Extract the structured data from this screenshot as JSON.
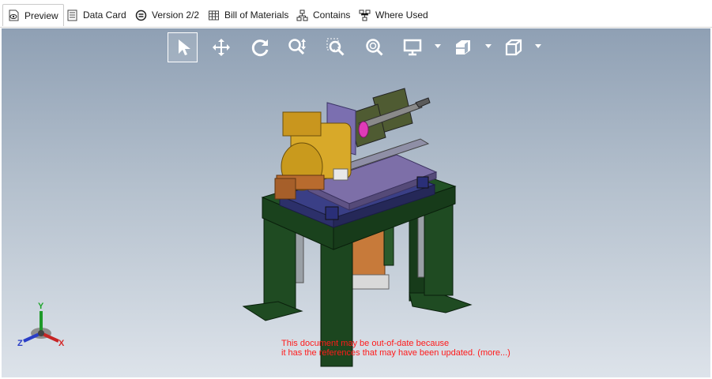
{
  "tabs": [
    {
      "label": "Preview",
      "icon": "eye-document-icon",
      "active": true
    },
    {
      "label": "Data Card",
      "icon": "data-card-icon"
    },
    {
      "label": "Version 2/2",
      "icon": "version-icon"
    },
    {
      "label": "Bill of Materials",
      "icon": "table-icon"
    },
    {
      "label": "Contains",
      "icon": "hierarchy-icon"
    },
    {
      "label": "Where Used",
      "icon": "where-used-icon"
    }
  ],
  "toolbar": {
    "buttons": [
      {
        "name": "select-tool",
        "icon": "arrow-cursor-icon",
        "selected": true
      },
      {
        "name": "pan-tool",
        "icon": "move-arrows-icon"
      },
      {
        "name": "rotate-tool",
        "icon": "rotate-icon"
      },
      {
        "name": "zoom-in-out-tool",
        "icon": "zoom-in-out-icon"
      },
      {
        "name": "zoom-to-area-tool",
        "icon": "zoom-area-icon"
      },
      {
        "name": "zoom-to-fit-tool",
        "icon": "zoom-fit-icon"
      },
      {
        "name": "display-style-tool",
        "icon": "monitor-icon",
        "dropdown": true
      },
      {
        "name": "section-view-tool",
        "icon": "section-view-icon",
        "dropdown": true
      },
      {
        "name": "view-orientation-tool",
        "icon": "cube-view-icon",
        "dropdown": true
      }
    ]
  },
  "triad": {
    "x_label": "X",
    "y_label": "Y",
    "z_label": "Z"
  },
  "warning": {
    "line1": "This document may be out-of-date because",
    "line2": "it has the references that may have been updated.",
    "more_link": "(more...)"
  },
  "colors": {
    "warning_text": "#ff1a1a",
    "viewport_top": "#8fa0b4",
    "viewport_bottom": "#dde3ea",
    "frame_green": "#1f4b22",
    "plate_blue": "#3a3f86",
    "motor_gold": "#d8a929"
  }
}
